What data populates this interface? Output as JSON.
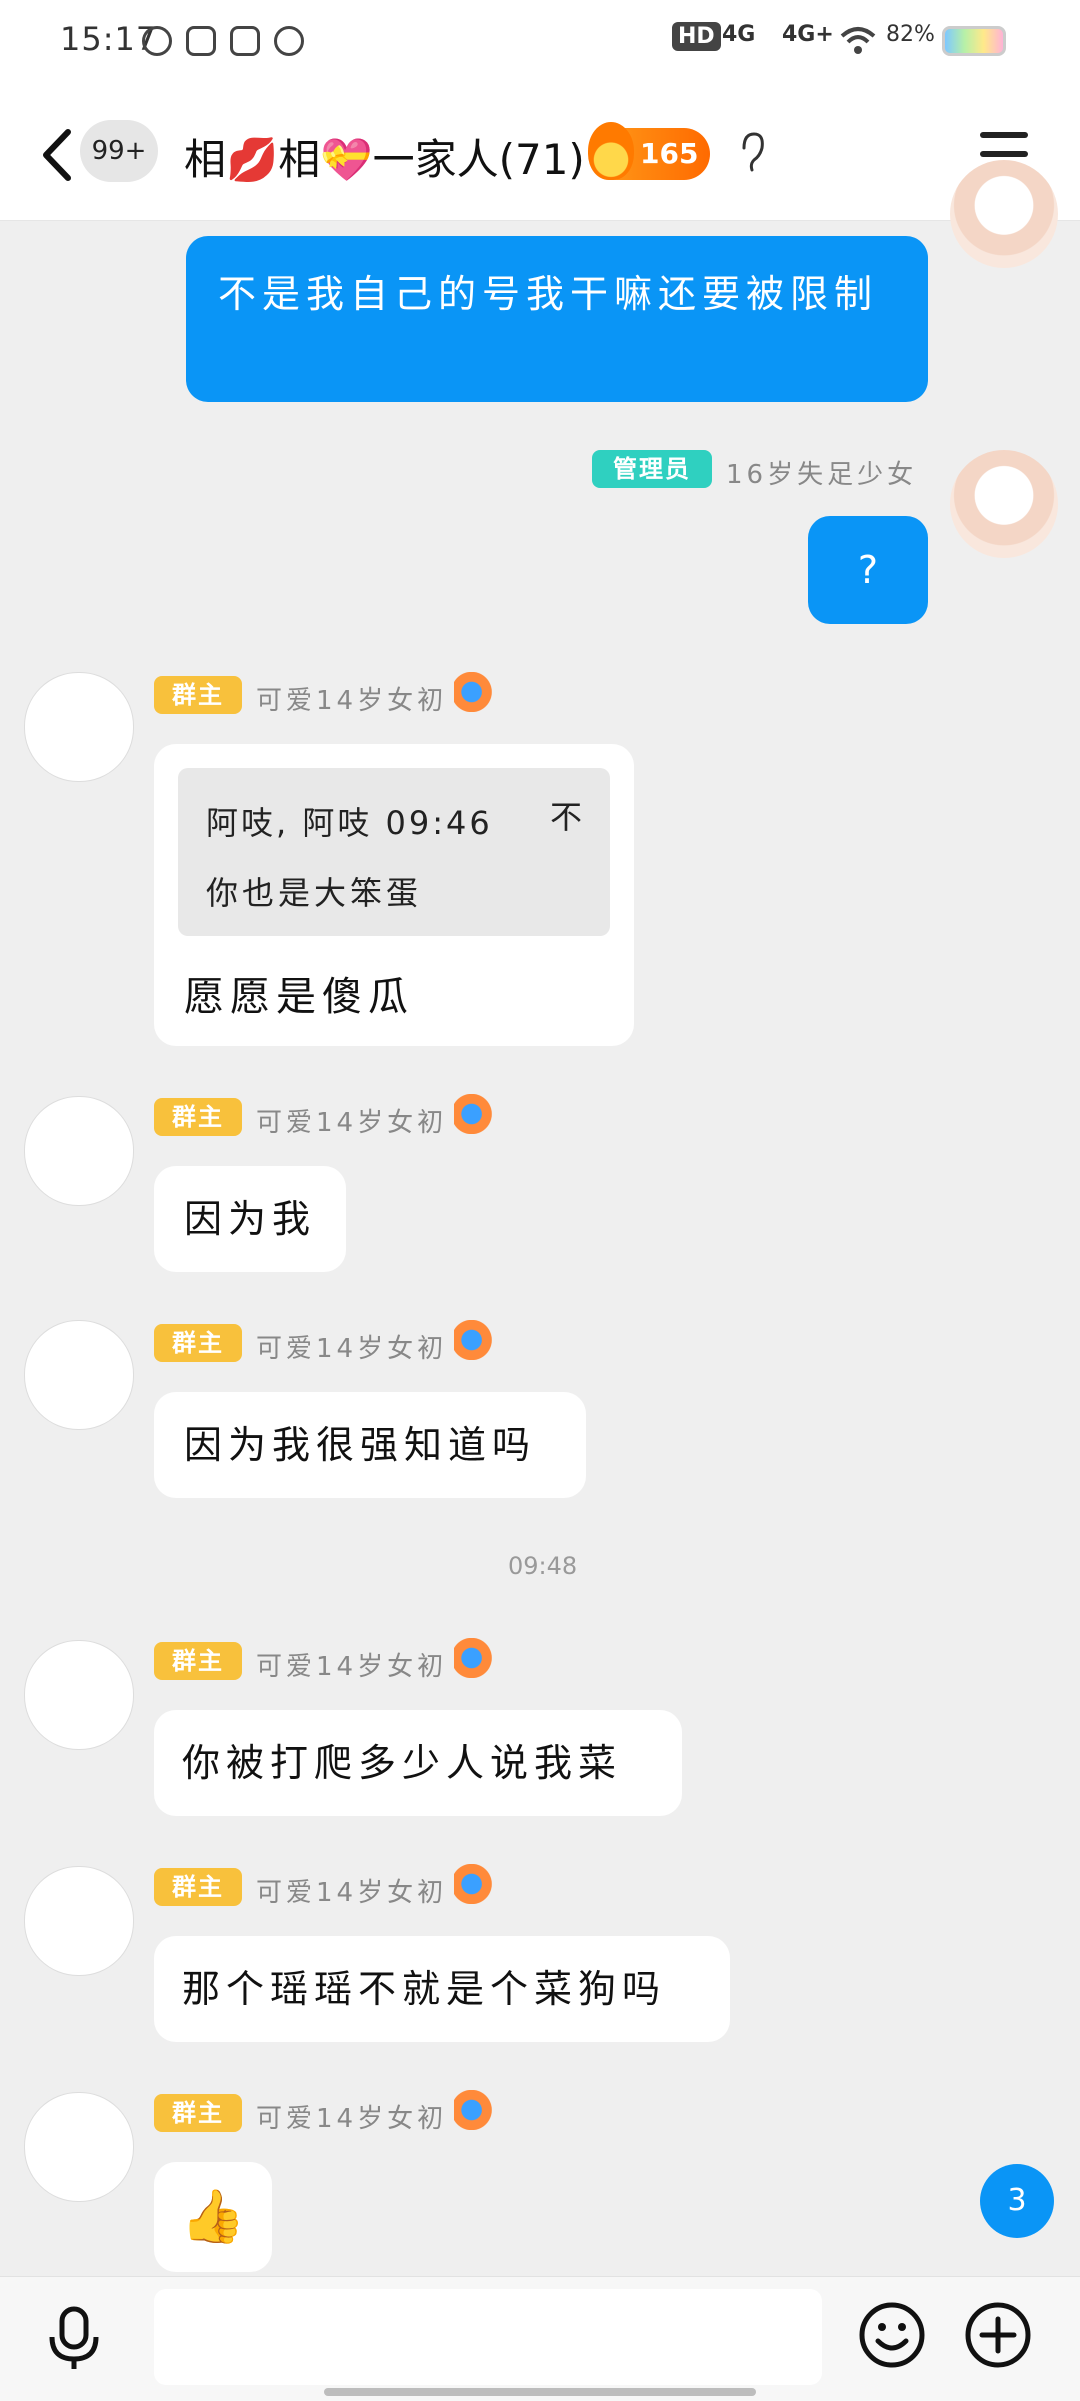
{
  "status_bar": {
    "time": "15:17",
    "network_1": "HD",
    "network_2": "4G",
    "network_3": "4G+",
    "battery": "82%"
  },
  "header": {
    "unread_count": "99+",
    "title": "相💋相💝一家人(71)",
    "fire_level": "165"
  },
  "messages": [
    {
      "text": "不是我自己的号我干嘛还要被限制"
    },
    {
      "sender_tag": "管理员",
      "sender_nick": "16岁失足少女",
      "text": "?"
    },
    {
      "sender_tag": "群主",
      "sender_nick": "可爱14岁女初",
      "quote_header": "阿吱, 阿吱 09:46",
      "quote_trailing": "不",
      "quote_text": "你也是大笨蛋",
      "text": "愿愿是傻瓜"
    },
    {
      "sender_tag": "群主",
      "sender_nick": "可爱14岁女初",
      "text": "因为我"
    },
    {
      "sender_tag": "群主",
      "sender_nick": "可爱14岁女初",
      "text": "因为我很强知道吗"
    },
    {
      "time_separator": "09:48"
    },
    {
      "sender_tag": "群主",
      "sender_nick": "可爱14岁女初",
      "text": "你被打爬多少人说我菜"
    },
    {
      "sender_tag": "群主",
      "sender_nick": "可爱14岁女初",
      "text": "那个瑶瑶不就是个菜狗吗"
    },
    {
      "sender_tag": "群主",
      "sender_nick": "可爱14岁女初",
      "text": "👍"
    }
  ],
  "new_message_count": "3",
  "input_bar": {
    "placeholder": ""
  }
}
